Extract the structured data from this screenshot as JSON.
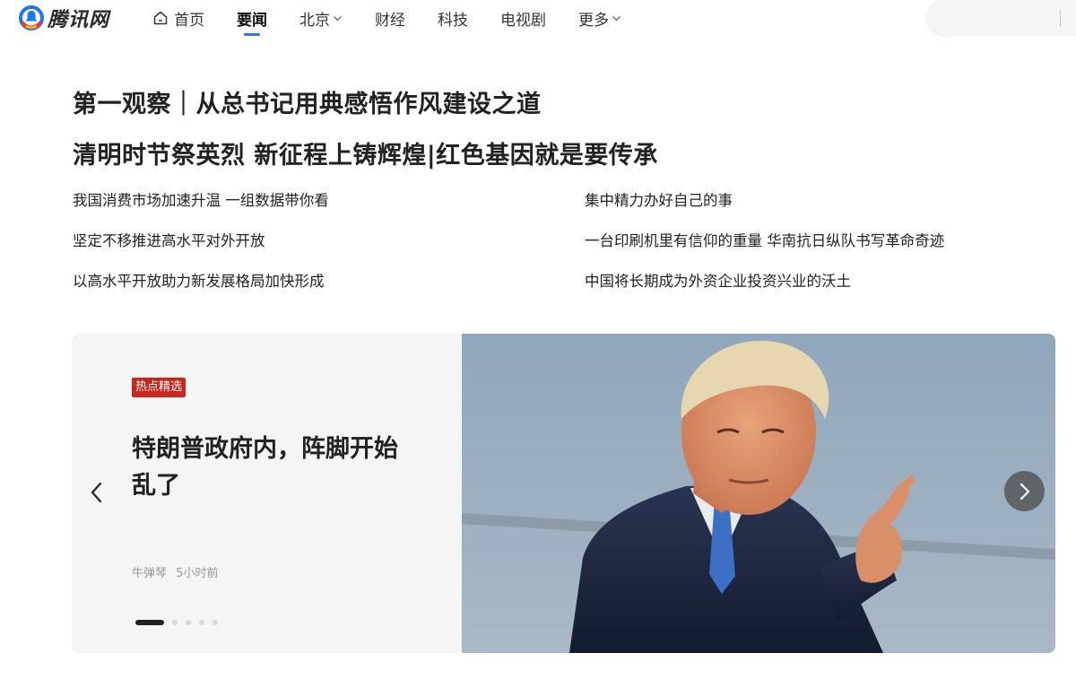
{
  "brand": {
    "name": "腾讯网"
  },
  "nav": {
    "items": [
      {
        "label": "首页",
        "icon": "home-icon"
      },
      {
        "label": "要闻",
        "active": true
      },
      {
        "label": "北京",
        "dropdown": true
      },
      {
        "label": "财经"
      },
      {
        "label": "科技"
      },
      {
        "label": "电视剧"
      },
      {
        "label": "更多",
        "dropdown": true
      }
    ],
    "accent": "#2d76ff"
  },
  "search": {
    "placeholder": "",
    "value": ""
  },
  "headlines": [
    "第一观察｜从总书记用典感悟作风建设之道",
    "清明时节祭英烈 新征程上铸辉煌|红色基因就是要传承"
  ],
  "news": {
    "left": [
      "我国消费市场加速升温 一组数据带你看",
      "坚定不移推进高水平对外开放",
      "以高水平开放助力新发展格局加快形成"
    ],
    "right": [
      "集中精力办好自己的事",
      "一台印刷机里有信仰的重量 华南抗日纵队书写革命奇迹",
      "中国将长期成为外资企业投资兴业的沃土"
    ]
  },
  "carousel": {
    "badge": "热点精选",
    "badge_color": "#c9261d",
    "title": "特朗普政府内，阵脚开始乱了",
    "author": "牛弹琴",
    "time": "5小时前",
    "slide_count": 5,
    "active_slide": 1,
    "image": "photo-man-in-suit-pointing"
  }
}
